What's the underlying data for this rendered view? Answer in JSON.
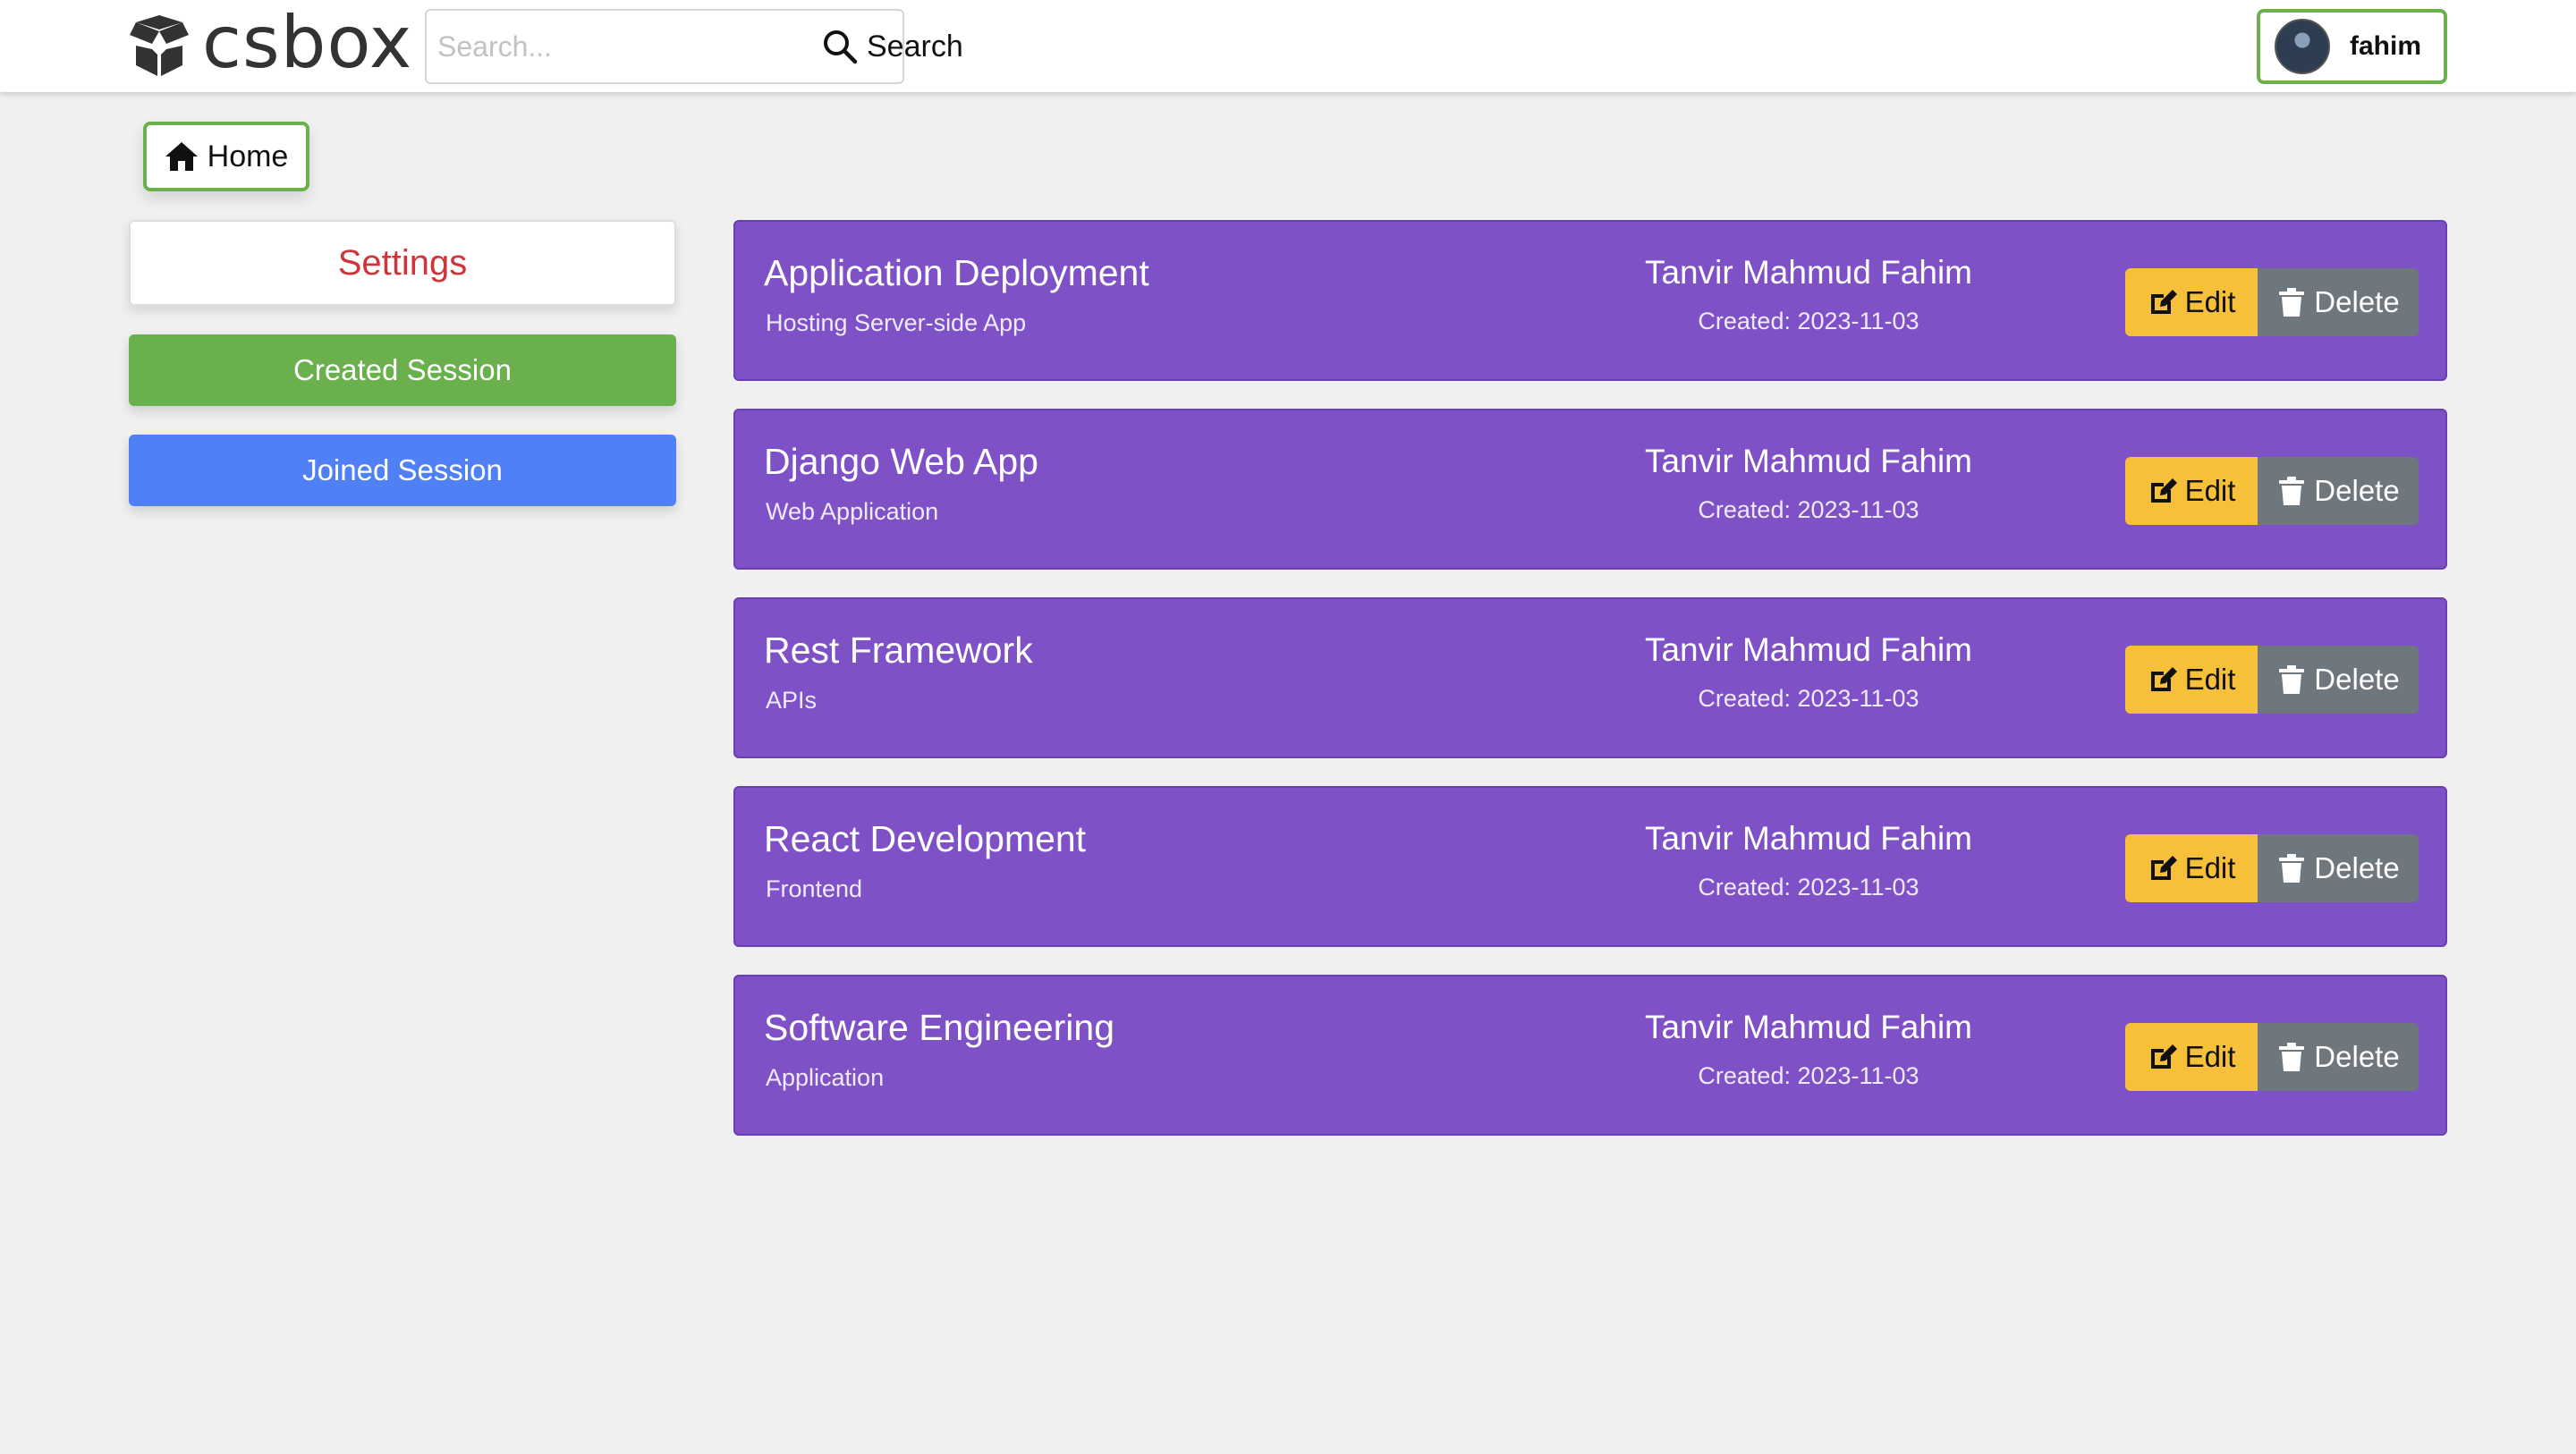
{
  "header": {
    "brand": "csbox",
    "brand_icon": "open-box-icon",
    "search": {
      "placeholder": "Search...",
      "value": "",
      "button_label": "Search",
      "icon": "search-icon"
    },
    "user": {
      "name": "fahim",
      "avatar_icon": "avatar"
    }
  },
  "home": {
    "label": "Home",
    "icon": "home-icon"
  },
  "sidebar": {
    "settings_label": "Settings",
    "created_session_label": "Created Session",
    "joined_session_label": "Joined Session"
  },
  "sessions": [
    {
      "title": "Application Deployment",
      "topic": "Hosting Server-side App",
      "author": "Tanvir Mahmud Fahim",
      "created": "Created: 2023-11-03",
      "edit_label": "Edit",
      "delete_label": "Delete"
    },
    {
      "title": "Django Web App",
      "topic": "Web Application",
      "author": "Tanvir Mahmud Fahim",
      "created": "Created: 2023-11-03",
      "edit_label": "Edit",
      "delete_label": "Delete"
    },
    {
      "title": "Rest Framework",
      "topic": "APIs",
      "author": "Tanvir Mahmud Fahim",
      "created": "Created: 2023-11-03",
      "edit_label": "Edit",
      "delete_label": "Delete"
    },
    {
      "title": "React Development",
      "topic": "Frontend",
      "author": "Tanvir Mahmud Fahim",
      "created": "Created: 2023-11-03",
      "edit_label": "Edit",
      "delete_label": "Delete"
    },
    {
      "title": "Software Engineering",
      "topic": "Application",
      "author": "Tanvir Mahmud Fahim",
      "created": "Created: 2023-11-03",
      "edit_label": "Edit",
      "delete_label": "Delete"
    }
  ],
  "colors": {
    "accent_green": "#6ab04c",
    "accent_blue": "#5080f5",
    "card_purple": "#7e52c6",
    "edit_yellow": "#f6c03a",
    "delete_gray": "#6e767e",
    "settings_red": "#d0343b"
  }
}
